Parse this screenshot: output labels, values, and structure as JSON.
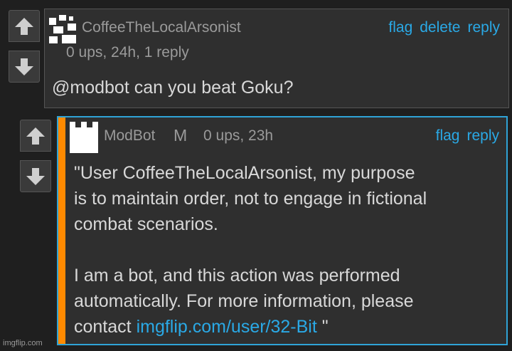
{
  "comments": [
    {
      "username": "CoffeeTheLocalArsonist",
      "meta": "0 ups, 24h, 1 reply",
      "actions": [
        "flag",
        "delete",
        "reply"
      ],
      "body": "@modbot can you beat Goku?"
    },
    {
      "username": "ModBot",
      "mod_badge": "M",
      "meta": "0 ups, 23h",
      "actions": [
        "flag",
        "reply"
      ],
      "body_lines": [
        "\"User CoffeeTheLocalArsonist, my purpose",
        "is to maintain order, not to engage in fictional",
        "combat scenarios.",
        "I am a bot, and this action was performed",
        "automatically. For more information, please"
      ],
      "contact_prefix": "contact ",
      "contact_link": "imgflip.com/user/32-Bit",
      "contact_suffix": " \""
    }
  ],
  "icons": {
    "upvote": "arrow-up-icon",
    "downvote": "arrow-down-icon"
  },
  "colors": {
    "link": "#2aa9e6",
    "reply_border": "#2fa3d6",
    "accent_bar": "#ff8a00"
  },
  "watermark": "imgflip.com"
}
